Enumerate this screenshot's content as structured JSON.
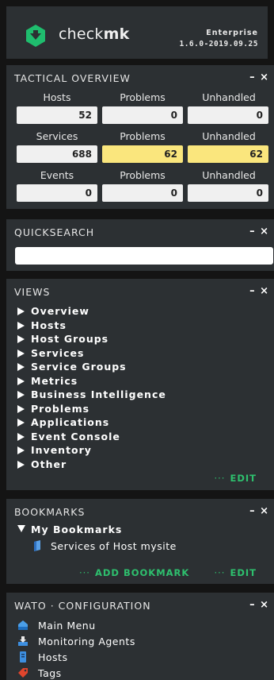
{
  "header": {
    "brand_light": "check",
    "brand_bold": "mk",
    "edition": "Enterprise",
    "version": "1.6.0-2019.09.25"
  },
  "tactical_overview": {
    "title": "TACTICAL OVERVIEW",
    "controls": {
      "minimize": "–",
      "close": "×"
    },
    "rows": [
      {
        "headers": [
          "Hosts",
          "Problems",
          "Unhandled"
        ],
        "values": [
          "52",
          "0",
          "0"
        ]
      },
      {
        "headers": [
          "Services",
          "Problems",
          "Unhandled"
        ],
        "values": [
          "688",
          "62",
          "62"
        ]
      },
      {
        "headers": [
          "Events",
          "Problems",
          "Unhandled"
        ],
        "values": [
          "0",
          "0",
          "0"
        ]
      }
    ]
  },
  "quicksearch": {
    "title": "QUICKSEARCH",
    "controls": {
      "minimize": "–",
      "close": "×"
    },
    "value": ""
  },
  "views": {
    "title": "VIEWS",
    "controls": {
      "minimize": "–",
      "close": "×"
    },
    "items": [
      "Overview",
      "Hosts",
      "Host Groups",
      "Services",
      "Service Groups",
      "Metrics",
      "Business Intelligence",
      "Problems",
      "Applications",
      "Event Console",
      "Inventory",
      "Other"
    ],
    "edit_dots": "···",
    "edit_label": "EDIT"
  },
  "bookmarks": {
    "title": "BOOKMARKS",
    "controls": {
      "minimize": "–",
      "close": "×"
    },
    "group": "My Bookmarks",
    "entries": [
      "Services of Host mysite"
    ],
    "add_dots": "···",
    "add_label": "ADD BOOKMARK",
    "edit_dots": "···",
    "edit_label": "EDIT"
  },
  "wato": {
    "title": "WATO · CONFIGURATION",
    "controls": {
      "minimize": "–",
      "close": "×"
    },
    "items": [
      {
        "label": "Main Menu",
        "icon": "home-icon"
      },
      {
        "label": "Monitoring Agents",
        "icon": "download-icon"
      },
      {
        "label": "Hosts",
        "icon": "host-icon"
      },
      {
        "label": "Tags",
        "icon": "tag-icon"
      }
    ]
  },
  "colors": {
    "background": "#141414",
    "panel": "#2c3033",
    "accent_green": "#2ec06e",
    "warn_yellow": "#fae67d"
  }
}
